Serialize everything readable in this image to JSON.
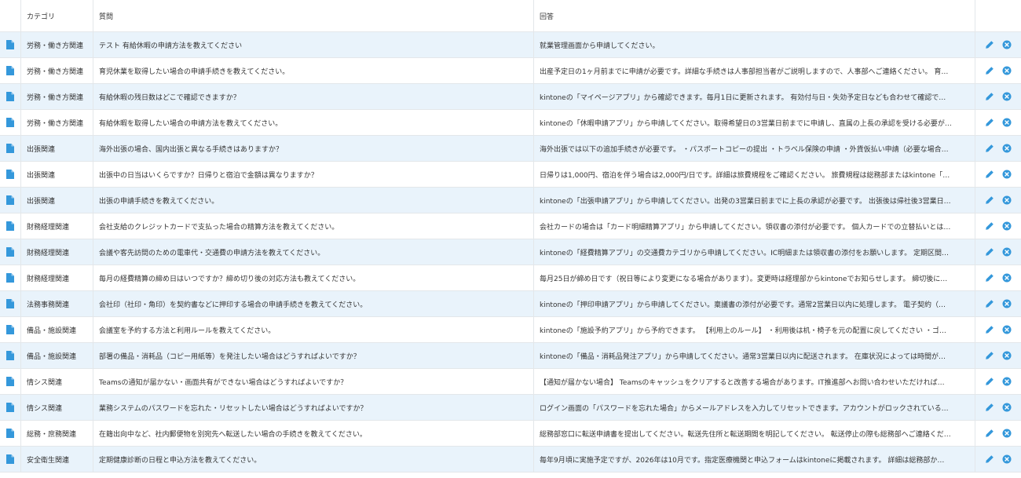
{
  "colors": {
    "accent": "#3498db",
    "row_alt": "#e9f3fb",
    "border": "#e3e7ea"
  },
  "icons": {
    "record": "document-icon",
    "edit": "pencil-icon",
    "delete": "close-circle-icon"
  },
  "columns": {
    "category": "カテゴリ",
    "question": "質問",
    "answer": "回答"
  },
  "rows": [
    {
      "category": "労務・働き方関連",
      "question": "テスト 有給休暇の申請方法を教えてください",
      "answer": "就業管理画面から申請してください。"
    },
    {
      "category": "労務・働き方関連",
      "question": "育児休業を取得したい場合の申請手続きを教えてください。",
      "answer": "出産予定日の1ヶ月前までに申請が必要です。詳細な手続きは人事部担当者がご説明しますので、人事部へご連絡ください。 育…"
    },
    {
      "category": "労務・働き方関連",
      "question": "有給休暇の残日数はどこで確認できますか？",
      "answer": "kintoneの「マイページアプリ」から確認できます。毎月1日に更新されます。 有効付与日・失効予定日なども合わせて確認で…"
    },
    {
      "category": "労務・働き方関連",
      "question": "有給休暇を取得したい場合の申請方法を教えてください。",
      "answer": "kintoneの「休暇申請アプリ」から申請してください。取得希望日の3営業日前までに申請し、直属の上長の承認を受ける必要が…"
    },
    {
      "category": "出張関連",
      "question": "海外出張の場合、国内出張と異なる手続きはありますか？",
      "answer": "海外出張では以下の追加手続きが必要です。 ・パスポートコピーの提出 ・トラベル保険の申請 ・外貨仮払い申請（必要な場合…"
    },
    {
      "category": "出張関連",
      "question": "出張中の日当はいくらですか？日帰りと宿泊で金額は異なりますか？",
      "answer": "日帰りは1,000円、宿泊を伴う場合は2,000円/日です。詳細は旅費規程をご確認ください。 旅費規程は総務部またはkintone「…"
    },
    {
      "category": "出張関連",
      "question": "出張の申請手続きを教えてください。",
      "answer": "kintoneの「出張申請アプリ」から申請してください。出発の3営業日前までに上長の承認が必要です。 出張後は帰社後3営業日…"
    },
    {
      "category": "財務経理関連",
      "question": "会社支給のクレジットカードで支払った場合の精算方法を教えてください。",
      "answer": "会社カードの場合は「カード明細精算アプリ」から申請してください。領収書の添付が必要です。 個人カードでの立替払いとは…"
    },
    {
      "category": "財務経理関連",
      "question": "会議や客先訪問のための電車代・交通費の申請方法を教えてください。",
      "answer": "kintoneの「経費精算アプリ」の交通費カテゴリから申請してください。IC明細または領収書の添付をお願いします。 定期区間…"
    },
    {
      "category": "財務経理関連",
      "question": "毎月の経費精算の締め日はいつですか？締め切り後の対応方法も教えてください。",
      "answer": "毎月25日が締め日です（祝日等により変更になる場合があります）。変更時は経理部からkintoneでお知らせします。 締切後に…"
    },
    {
      "category": "法務事務関連",
      "question": "会社印（社印・角印）を契約書などに押印する場合の申請手続きを教えてください。",
      "answer": "kintoneの「押印申請アプリ」から申請してください。稟議書の添付が必要です。通常2営業日以内に処理します。 電子契約（…"
    },
    {
      "category": "備品・施設関連",
      "question": "会議室を予約する方法と利用ルールを教えてください。",
      "answer": "kintoneの「施設予約アプリ」から予約できます。 【利用上のルール】 ・利用後は机・椅子を元の配置に戻してください ・ゴ…"
    },
    {
      "category": "備品・施設関連",
      "question": "部署の備品・消耗品（コピー用紙等）を発注したい場合はどうすればよいですか？",
      "answer": "kintoneの「備品・消耗品発注アプリ」から申請してください。通常3営業日以内に配送されます。 在庫状況によっては時間が…"
    },
    {
      "category": "情シス関連",
      "question": "Teamsの通知が届かない・画面共有ができない場合はどうすればよいですか？",
      "answer": "【通知が届かない場合】 Teamsのキャッシュをクリアすると改善する場合があります。IT推進部へお問い合わせいただければ…"
    },
    {
      "category": "情シス関連",
      "question": "業務システムのパスワードを忘れた・リセットしたい場合はどうすればよいですか？",
      "answer": "ログイン画面の「パスワードを忘れた場合」からメールアドレスを入力してリセットできます。アカウントがロックされている…"
    },
    {
      "category": "総務・庶務関連",
      "question": "在籍出向中など、社内郵便物を別宛先へ転送したい場合の手続きを教えてください。",
      "answer": "総務部窓口に転送申請書を提出してください。転送先住所と転送期間を明記してください。 転送停止の際も総務部へご連絡くだ…"
    },
    {
      "category": "安全衛生関連",
      "question": "定期健康診断の日程と申込方法を教えてください。",
      "answer": "毎年9月頃に実施予定ですが、2026年は10月です。指定医療機関と申込フォームはkintoneに掲載されます。 詳細は総務部か…"
    }
  ]
}
